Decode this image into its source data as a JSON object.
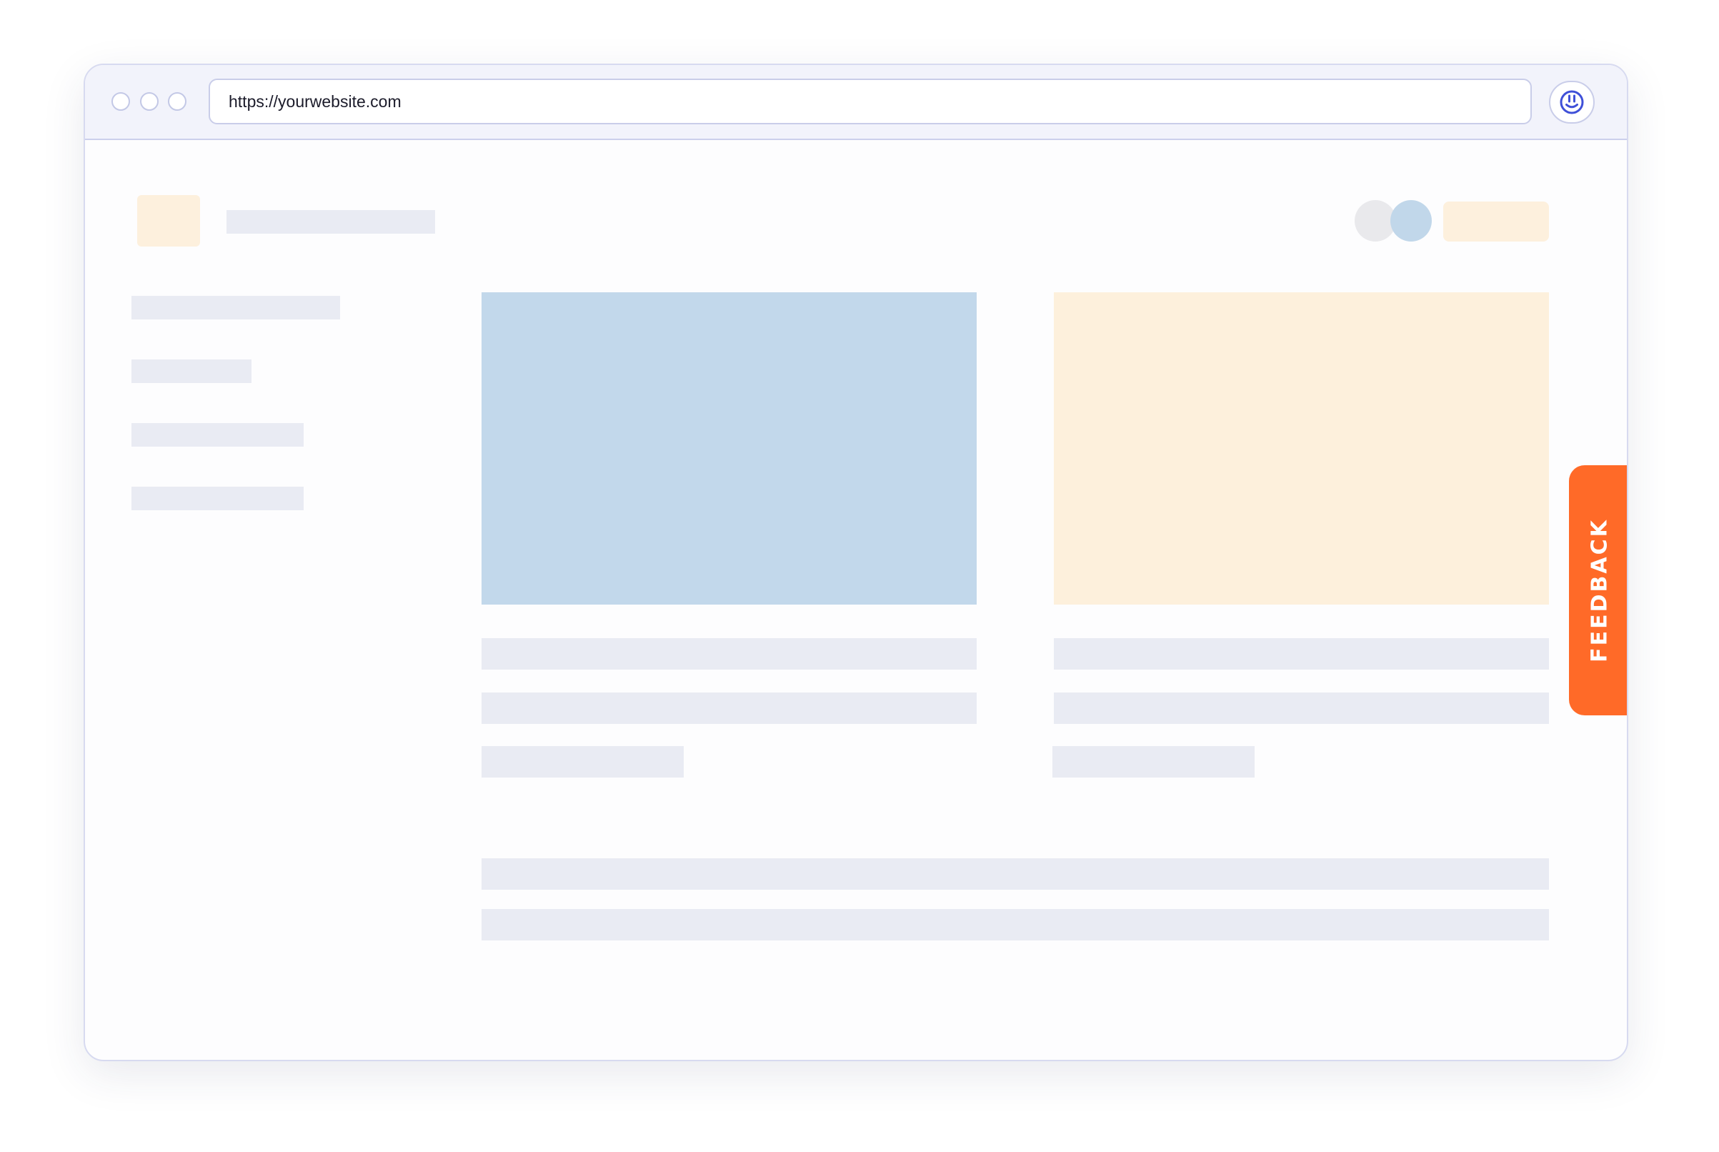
{
  "browser": {
    "url": "https://yourwebsite.com"
  },
  "icons": {
    "extension": "smiley-feedback-icon"
  },
  "feedback_tab": {
    "label": "FEEDBACK"
  },
  "colors": {
    "feedback_accent": "#ff6a28",
    "placeholder_blue": "#c2d8eb",
    "placeholder_cream": "#fdf0dc",
    "skeleton_bar": "#e9ebf3",
    "extension_icon": "#3f50d8"
  }
}
